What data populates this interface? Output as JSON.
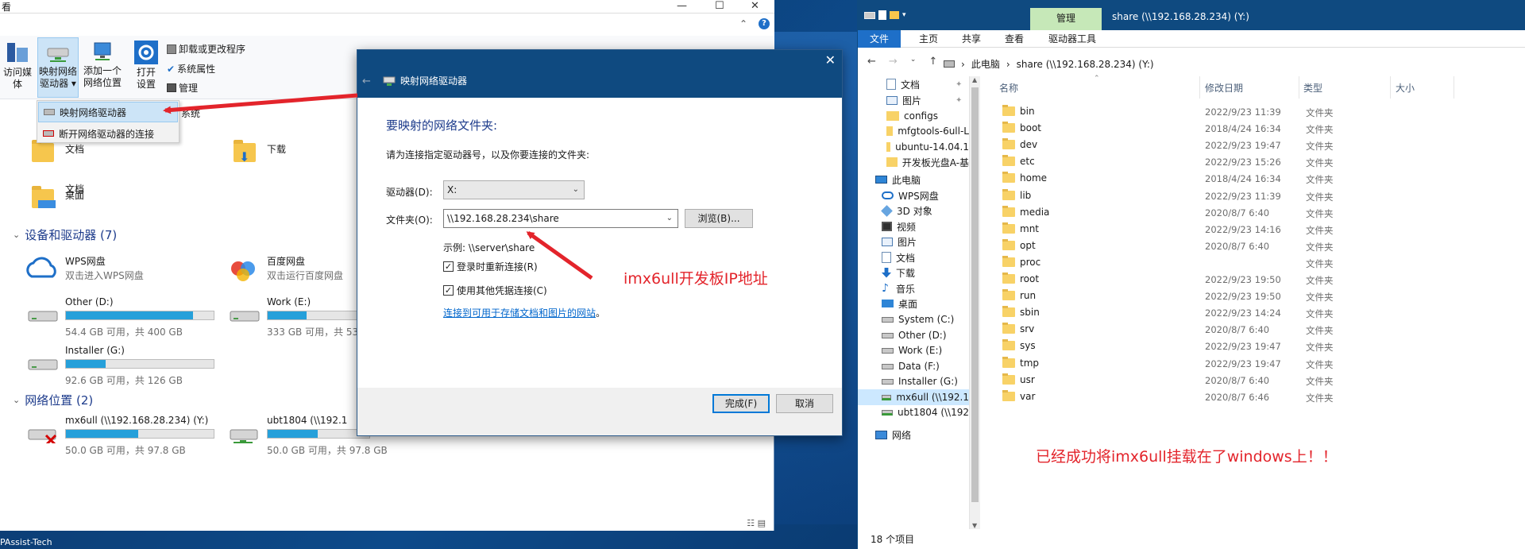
{
  "left_window": {
    "title": "看",
    "ribbon": {
      "media_label_1": "访问媒体",
      "map_drive_label_1": "映射网络",
      "map_drive_label_2": "驱动器 ▾",
      "add_location_label_1": "添加一个",
      "add_location_label_2": "网络位置",
      "open_settings_label_1": "打开",
      "open_settings_label_2": "设置",
      "uninstall": "卸载或更改程序",
      "sys_props": "系统属性",
      "manage": "管理"
    },
    "dropdown": {
      "map_drive": "映射网络驱动器",
      "disconnect": "断开网络驱动器的连接",
      "partial_system": "系统"
    },
    "folders": {
      "documents": "文档",
      "downloads": "下载",
      "desktop": "桌面"
    },
    "devices_section": "设备和驱动器 (7)",
    "network_section": "网络位置 (2)",
    "drives": [
      {
        "name": "WPS网盘",
        "sub": "双击进入WPS网盘"
      },
      {
        "name": "百度网盘",
        "sub": "双击运行百度网盘"
      },
      {
        "name": "Other (D:)",
        "free": "54.4 GB 可用，共 400 GB",
        "used": 0.86
      },
      {
        "name": "Work (E:)",
        "free": "333 GB 可用，共 53",
        "used": 0.38
      },
      {
        "name": "Installer (G:)",
        "free": "92.6 GB 可用，共 126 GB",
        "used": 0.27
      }
    ],
    "network": [
      {
        "name": "mx6ull (\\\\192.168.28.234) (Y:)",
        "free": "50.0 GB 可用，共 97.8 GB",
        "used": 0.49
      },
      {
        "name": "ubt1804 (\\\\192.1",
        "free": "50.0 GB 可用，共 97.8 GB",
        "used": 0.49
      }
    ]
  },
  "dialog": {
    "title": "映射网络驱动器",
    "heading": "要映射的网络文件夹:",
    "instruction": "请为连接指定驱动器号，以及你要连接的文件夹:",
    "drive_label": "驱动器(D):",
    "drive_value": "X:",
    "folder_label": "文件夹(O):",
    "folder_value": "\\\\192.168.28.234\\share",
    "browse": "浏览(B)...",
    "example": "示例: \\\\server\\share",
    "reconnect": "登录时重新连接(R)",
    "other_creds": "使用其他凭据连接(C)",
    "link_text": "连接到可用于存储文档和图片的网站",
    "link_suffix": "。",
    "finish": "完成(F)",
    "cancel": "取消"
  },
  "right_window": {
    "manage_tab": "管理",
    "caption": "share (\\\\192.168.28.234) (Y:)",
    "tabs": [
      "文件",
      "主页",
      "共享",
      "查看",
      "驱动器工具"
    ],
    "path": [
      "此电脑",
      "share (\\\\192.168.28.234) (Y:)"
    ],
    "columns": {
      "name": "名称",
      "date": "修改日期",
      "type": "类型",
      "size": "大小"
    },
    "nav": [
      {
        "label": "文档",
        "icon": "doc",
        "pin": true
      },
      {
        "label": "图片",
        "icon": "pic",
        "pin": true
      },
      {
        "label": "configs",
        "icon": "folder"
      },
      {
        "label": "mfgtools-6ull-L",
        "icon": "folder"
      },
      {
        "label": "ubuntu-14.04.1",
        "icon": "folder"
      },
      {
        "label": "开发板光盘A-基",
        "icon": "folder"
      },
      {
        "label": "此电脑",
        "icon": "pc"
      },
      {
        "label": "WPS网盘",
        "icon": "cloud"
      },
      {
        "label": "3D 对象",
        "icon": "3d"
      },
      {
        "label": "视频",
        "icon": "video"
      },
      {
        "label": "图片",
        "icon": "pic"
      },
      {
        "label": "文档",
        "icon": "doc"
      },
      {
        "label": "下载",
        "icon": "down"
      },
      {
        "label": "音乐",
        "icon": "music"
      },
      {
        "label": "桌面",
        "icon": "desk"
      },
      {
        "label": "System (C:)",
        "icon": "drive"
      },
      {
        "label": "Other (D:)",
        "icon": "drive"
      },
      {
        "label": "Work (E:)",
        "icon": "drive"
      },
      {
        "label": "Data (F:)",
        "icon": "drive"
      },
      {
        "label": "Installer (G:)",
        "icon": "drive"
      },
      {
        "label": "mx6ull (\\\\192.1",
        "icon": "netdrive",
        "selected": true
      },
      {
        "label": "ubt1804 (\\\\192",
        "icon": "netdrive"
      },
      {
        "label": "网络",
        "icon": "net"
      }
    ],
    "files": [
      {
        "name": "bin",
        "date": "2022/9/23 11:39",
        "type": "文件夹"
      },
      {
        "name": "boot",
        "date": "2018/4/24 16:34",
        "type": "文件夹"
      },
      {
        "name": "dev",
        "date": "2022/9/23 19:47",
        "type": "文件夹"
      },
      {
        "name": "etc",
        "date": "2022/9/23 15:26",
        "type": "文件夹"
      },
      {
        "name": "home",
        "date": "2018/4/24 16:34",
        "type": "文件夹"
      },
      {
        "name": "lib",
        "date": "2022/9/23 11:39",
        "type": "文件夹"
      },
      {
        "name": "media",
        "date": "2020/8/7 6:40",
        "type": "文件夹"
      },
      {
        "name": "mnt",
        "date": "2022/9/23 14:16",
        "type": "文件夹"
      },
      {
        "name": "opt",
        "date": "2020/8/7 6:40",
        "type": "文件夹"
      },
      {
        "name": "proc",
        "date": "",
        "type": "文件夹"
      },
      {
        "name": "root",
        "date": "2022/9/23 19:50",
        "type": "文件夹"
      },
      {
        "name": "run",
        "date": "2022/9/23 19:50",
        "type": "文件夹"
      },
      {
        "name": "sbin",
        "date": "2022/9/23 14:24",
        "type": "文件夹"
      },
      {
        "name": "srv",
        "date": "2020/8/7 6:40",
        "type": "文件夹"
      },
      {
        "name": "sys",
        "date": "2022/9/23 19:47",
        "type": "文件夹"
      },
      {
        "name": "tmp",
        "date": "2022/9/23 19:47",
        "type": "文件夹"
      },
      {
        "name": "usr",
        "date": "2020/8/7 6:40",
        "type": "文件夹"
      },
      {
        "name": "var",
        "date": "2020/8/7 6:46",
        "type": "文件夹"
      }
    ],
    "status": "18 个项目"
  },
  "annotations": {
    "ip_note": "imx6ull开发板IP地址",
    "success_note": "已经成功将imx6ull挂载在了windows上！！"
  },
  "desktop": {
    "label": "PAssist-Tech"
  },
  "colors": {
    "accent": "#0f4a80",
    "annotation": "#e3242b",
    "selection": "#cce4f7"
  }
}
